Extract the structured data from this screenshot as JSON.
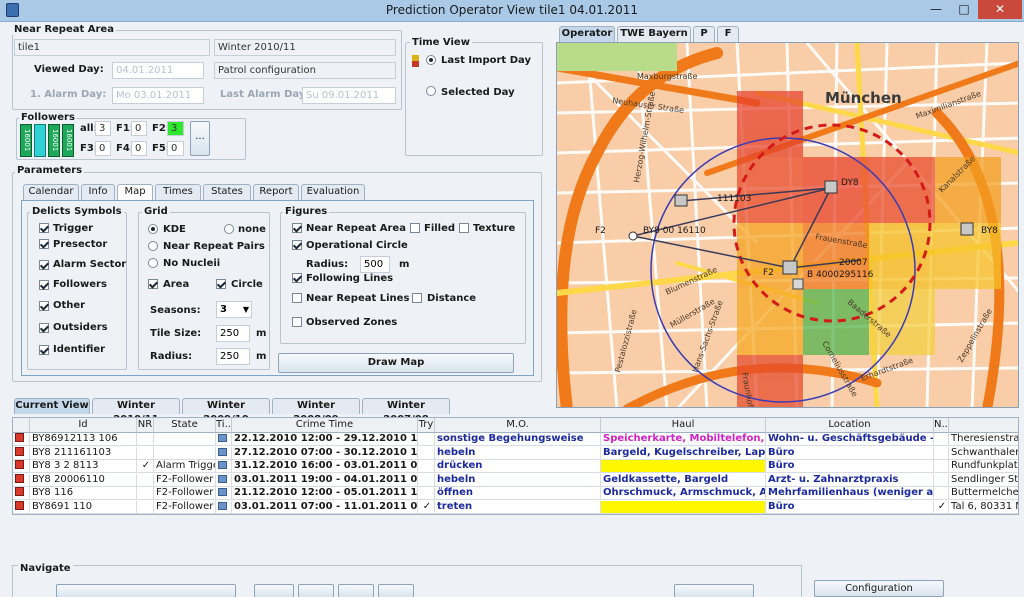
{
  "window": {
    "title": "Prediction Operator View tile1 04.01.2011",
    "minimize": "—",
    "maximize": "□",
    "close": "✕"
  },
  "near_repeat": {
    "group_label": "Near Repeat Area",
    "tile_value": "tile1",
    "season_value": "Winter 2010/11",
    "viewed_day_label": "Viewed Day:",
    "viewed_day_value": "04.01.2011",
    "patrol_value": "Patrol configuration",
    "alarm_day_label": "1. Alarm Day:",
    "alarm_day_value": "Mo 03.01.2011",
    "last_alarm_label": "Last Alarm Day:",
    "last_alarm_value": "Su 09.01.2011"
  },
  "time_view": {
    "label": "Time View",
    "last_import": "Last Import Day",
    "selected_day": "Selected Day"
  },
  "followers": {
    "label": "Followers",
    "all_label": "all:",
    "all_value": "3",
    "f1_label": "F1:",
    "f1_value": "0",
    "f2_label": "F2:",
    "f2_value": "3",
    "f3_label": "F3:",
    "f3_value": "0",
    "f4_label": "F4:",
    "f4_value": "0",
    "f5_label": "F5:",
    "f5_value": "0",
    "more_button": "...",
    "bars": [
      "16001",
      "",
      "16001",
      "16001"
    ]
  },
  "parameters": {
    "label": "Parameters",
    "tabs": [
      "Calendar",
      "Info",
      "Map",
      "Times",
      "States",
      "Report",
      "Evaluation"
    ],
    "delicts_label": "Delicts Symbols",
    "delicts": [
      "Trigger",
      "Presector",
      "Alarm Sector",
      "Followers",
      "Other",
      "Outsiders",
      "Identifier"
    ],
    "grid_label": "Grid",
    "kde": "KDE",
    "none": "none",
    "near_repeat_pairs": "Near Repeat Pairs",
    "no_nuclei": "No Nucleii",
    "area": "Area",
    "circle": "Circle",
    "seasons_label": "Seasons:",
    "seasons_value": "3",
    "tile_size_label": "Tile Size:",
    "tile_size_value": "250",
    "tile_size_unit": "m",
    "radius_label": "Radius:",
    "radius_value": "250",
    "radius_unit": "m",
    "figures_label": "Figures",
    "near_repeat_area": "Near Repeat Area",
    "filled": "Filled",
    "texture": "Texture",
    "operational_circle": "Operational Circle",
    "fig_radius_label": "Radius:",
    "fig_radius_value": "500",
    "fig_radius_unit": "m",
    "following_lines": "Following Lines",
    "near_repeat_lines": "Near Repeat Lines",
    "distance": "Distance",
    "observed_zones": "Observed Zones",
    "draw_map": "Draw Map"
  },
  "map_tabs": [
    "Operator",
    "TWE Bayern",
    "P",
    "F"
  ],
  "map": {
    "city": "München",
    "streets": [
      "Maxburgstraße",
      "Neuhauser Straße",
      "Herzog-Wilhelm-Straße",
      "Prielmayerstraße",
      "Frauenstraße",
      "Blumenstraße",
      "Müllerstraße",
      "Reichenbachstraße",
      "Corneliusstraße",
      "Erhardtstraße",
      "Fraunhoferstraße",
      "Baaderstraße",
      "Residenzstraße",
      "Maximilianstraße",
      "Zweibrückenstraße",
      "Pestalozzistraße",
      "Hans-Sachs-Straße",
      "Theresienhöhe",
      "Kanalstraße",
      "Zeppelinstraße"
    ],
    "markers": [
      "BY8",
      "111103",
      "F2",
      "BY8 00 16110",
      "F2",
      "B 4000295116",
      "DY8",
      "20007",
      "F2",
      "BY8"
    ]
  },
  "data_tabs": [
    "Current View",
    "Winter 2010/11",
    "Winter 2009/10",
    "Winter 2008/09",
    "Winter 2007/08"
  ],
  "table": {
    "columns": [
      "",
      "Id",
      "NR",
      "State",
      "Ti...",
      "Crime Time",
      "Try",
      "M.O.",
      "Haul",
      "Location",
      "N...",
      ""
    ],
    "rows": [
      {
        "id": "BY86912113 106",
        "nr": "",
        "state": "",
        "time": "22.12.2010 12:00 - 29.12.2010 19:00",
        "try": "",
        "mo": "sonstige Begehungsweise",
        "haul": "Speicherkarte, Mobiltelefon, Mitg...",
        "location": "Wohn- u. Geschäftsgebäude - W...",
        "n": "",
        "extra": "Theresienstraße"
      },
      {
        "id": "BY8 211161103",
        "nr": "",
        "state": "",
        "time": "27.12.2010 07:00 - 30.12.2010 10:00",
        "try": "",
        "mo": "hebeln",
        "haul": "Bargeld, Kugelschreiber, Laptop/...",
        "location": "Büro",
        "n": "",
        "extra": "Schwanthaler"
      },
      {
        "id": "BY8 3 2 8113",
        "nr": "✓",
        "state": "Alarm Trigger",
        "time": "31.12.2010 16:00 - 03.01.2011 08:00",
        "try": "",
        "mo": "drücken",
        "haul": "",
        "location": "Büro",
        "n": "",
        "extra": "Rundfunkplatz 4"
      },
      {
        "id": "BY8 20006110",
        "nr": "",
        "state": "F2-Follower (...",
        "time": "03.01.2011 19:00 - 04.01.2011 07:00",
        "try": "",
        "mo": "hebeln",
        "haul": "Geldkassette, Bargeld",
        "location": "Arzt- u. Zahnarztpraxis",
        "n": "",
        "extra": "Sendlinger Str"
      },
      {
        "id": "BY8 116",
        "nr": "",
        "state": "F2-Follower (...",
        "time": "21.12.2010 12:00 - 05.01.2011 14:00",
        "try": "",
        "mo": "öffnen",
        "haul": "Ohrschmuck, Armschmuck, Arm...",
        "location": "Mehrfamilienhaus (weniger als 9 ...",
        "n": "",
        "extra": "Buttermelcher"
      },
      {
        "id": "BY8691 110",
        "nr": "",
        "state": "F2-Follower (...",
        "time": "03.01.2011 07:00 - 11.01.2011 07:00",
        "try": "✓",
        "mo": "treten",
        "haul": "",
        "location": "Büro",
        "n": "✓",
        "extra": "Tal 6, 80331 M"
      }
    ]
  },
  "navigate": {
    "label": "Navigate",
    "configuration": "Configuration"
  }
}
